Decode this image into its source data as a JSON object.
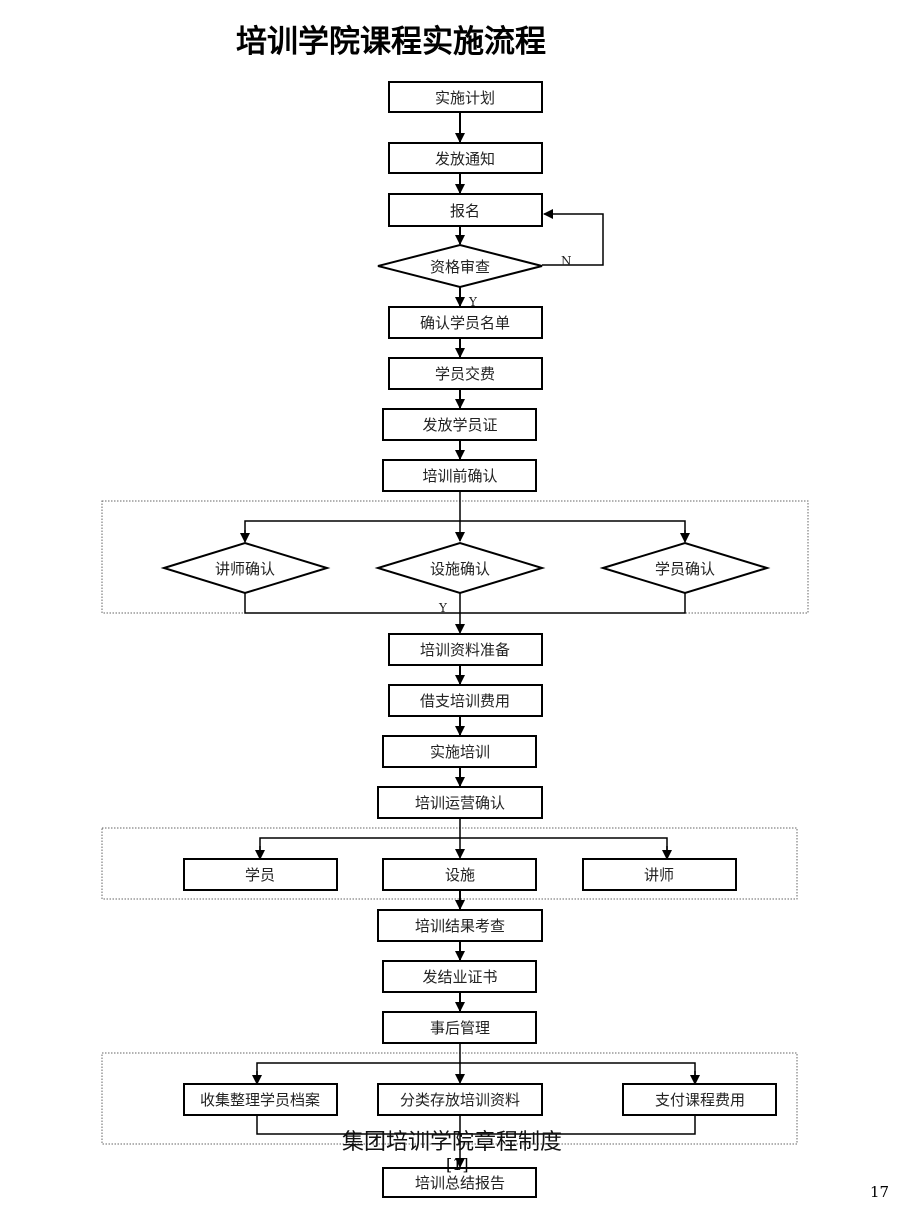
{
  "title": "培训学院课程实施流程",
  "nodes": {
    "plan": "实施计划",
    "notice": "发放通知",
    "signup": "报名",
    "qualify": "资格审查",
    "confirm_list": "确认学员名单",
    "fee": "学员交费",
    "card": "发放学员证",
    "pre_confirm": "培训前确认",
    "lecturer_confirm": "讲师确认",
    "facility_confirm": "设施确认",
    "student_confirm": "学员确认",
    "materials": "培训资料准备",
    "advance": "借支培训费用",
    "conduct": "实施培训",
    "ops_confirm": "培训运营确认",
    "students": "学员",
    "facilities": "设施",
    "lecturers": "讲师",
    "result_check": "培训结果考查",
    "certificate": "发结业证书",
    "post": "事后管理",
    "archive": "收集整理学员档案",
    "store": "分类存放培训资料",
    "pay": "支付课程费用",
    "summary": "培训总结报告"
  },
  "edge_labels": {
    "no": "N",
    "yes": "Y",
    "yes2": "Y"
  },
  "footer": "集团培训学院章程制度",
  "footnote": "[1]",
  "page_number": "17"
}
